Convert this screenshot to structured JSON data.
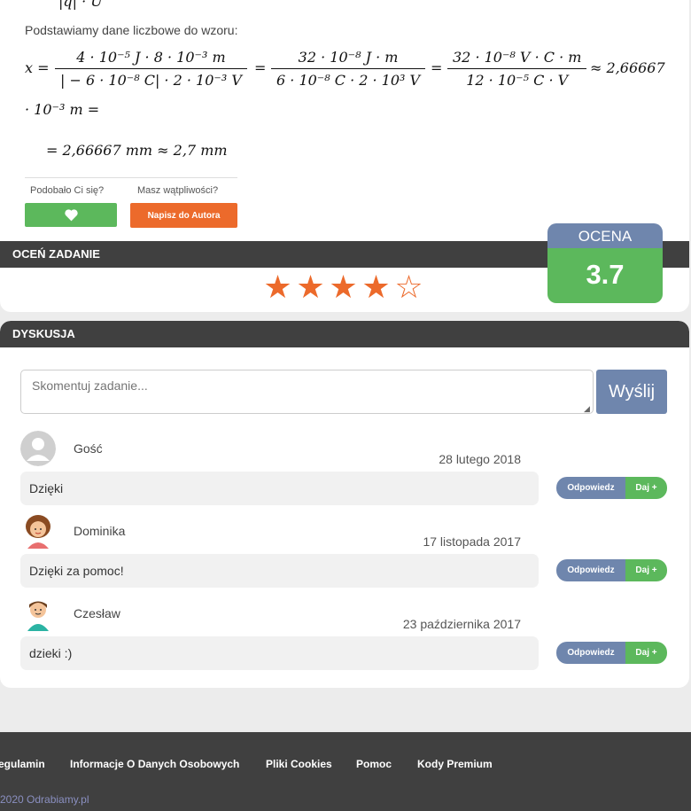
{
  "solution": {
    "top_fragment": "|q| · U",
    "intro": "Podstawiamy dane liczbowe do wzoru:",
    "eq": {
      "lhs": "x =",
      "f1_num": "4 · 10⁻⁵  J · 8 · 10⁻³  m",
      "f1_den": "| − 6 · 10⁻⁸  C| · 2 · 10⁻³  V",
      "eq1": "=",
      "f2_num": "32 · 10⁻⁸  J · m",
      "f2_den": "6 · 10⁻⁸  C · 2 · 10³  V",
      "eq2": "=",
      "f3_num": "32 · 10⁻⁸  V · C · m",
      "f3_den": "12 · 10⁻⁵  C · V",
      "approx": "≈ 2,66667",
      "line2": "· 10⁻³  m =",
      "line3": "= 2,66667  mm ≈ 2,7  mm"
    }
  },
  "feedback": {
    "liked_label": "Podobało Ci się?",
    "doubt_label": "Masz wątpliwości?",
    "author_button": "Napisz do Autora"
  },
  "rating": {
    "bar_title": "OCEŃ ZADANIE",
    "box_title": "OCENA",
    "value": "3.7",
    "stars": [
      "★",
      "★",
      "★",
      "★",
      "☆"
    ]
  },
  "discussion": {
    "bar_title": "DYSKUSJA",
    "placeholder": "Skomentuj zadanie...",
    "send_label": "Wyślij",
    "reply_label": "Odpowiedz",
    "plus_label": "Daj +",
    "comments": [
      {
        "name": "Gość",
        "date": "28 lutego 2018",
        "text": "Dzięki"
      },
      {
        "name": "Dominika",
        "date": "17 listopada 2017",
        "text": "Dzięki za pomoc!"
      },
      {
        "name": "Czesław",
        "date": "23 października 2017",
        "text": "dzieki :)"
      }
    ]
  },
  "footer": {
    "links": [
      "egulamin",
      "Informacje O Danych Osobowych",
      "Pliki Cookies",
      "Pomoc",
      "Kody Premium"
    ],
    "copyright": "2020 Odrabiamy.pl"
  },
  "colors": {
    "green": "#5cb85c",
    "orange": "#ec6a2b",
    "blue_grey": "#6f86ad",
    "dark_bar": "#404040"
  }
}
